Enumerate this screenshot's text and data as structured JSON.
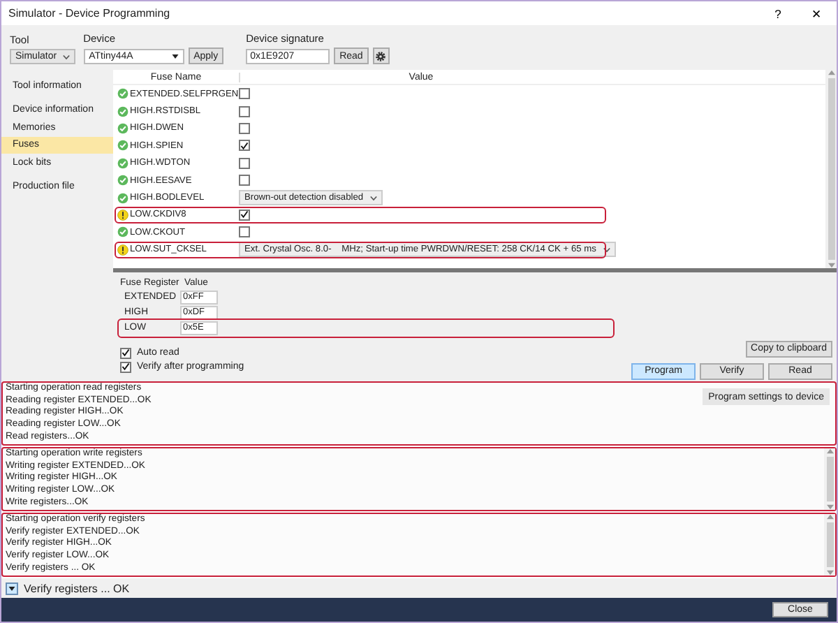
{
  "window": {
    "title": "Simulator - Device Programming",
    "help": "?",
    "close": "✕"
  },
  "toolbar": {
    "tool_label": "Tool",
    "tool": "Simulator",
    "device_label": "Device",
    "device": "ATtiny44A",
    "apply": "Apply",
    "signature_label": "Device signature",
    "signature": "0x1E9207",
    "read": "Read"
  },
  "sidebar": {
    "items": [
      {
        "label": "Tool information",
        "selected": false
      },
      {
        "label": "Device information",
        "selected": false
      },
      {
        "label": "Memories",
        "selected": false
      },
      {
        "label": "Fuses",
        "selected": true
      },
      {
        "label": "Lock bits",
        "selected": false
      },
      {
        "label": "Production file",
        "selected": false
      }
    ]
  },
  "fuses": {
    "columns": [
      "Fuse Name",
      "Value"
    ],
    "rows": [
      {
        "name": "EXTENDED.SELFPRGEN",
        "warning": false,
        "kind": "checkbox",
        "checked": false,
        "highlighted": false
      },
      {
        "name": "HIGH.RSTDISBL",
        "warning": false,
        "kind": "checkbox",
        "checked": false,
        "highlighted": false
      },
      {
        "name": "HIGH.DWEN",
        "warning": false,
        "kind": "checkbox",
        "checked": false,
        "highlighted": false
      },
      {
        "name": "HIGH.SPIEN",
        "warning": false,
        "kind": "checkbox",
        "checked": true,
        "highlighted": false
      },
      {
        "name": "HIGH.WDTON",
        "warning": false,
        "kind": "checkbox",
        "checked": false,
        "highlighted": false
      },
      {
        "name": "HIGH.EESAVE",
        "warning": false,
        "kind": "checkbox",
        "checked": false,
        "highlighted": false
      },
      {
        "name": "HIGH.BODLEVEL",
        "warning": false,
        "kind": "select",
        "value": "Brown-out detection disabled",
        "highlighted": false
      },
      {
        "name": "LOW.CKDIV8",
        "warning": true,
        "kind": "checkbox",
        "checked": true,
        "highlighted": true
      },
      {
        "name": "LOW.CKOUT",
        "warning": false,
        "kind": "checkbox",
        "checked": false,
        "highlighted": false
      },
      {
        "name": "LOW.SUT_CKSEL",
        "warning": true,
        "kind": "select",
        "value": "Ext. Crystal Osc. 8.0-    MHz; Start-up time PWRDWN/RESET: 258 CK/14 CK + 65 ms",
        "highlighted": true
      }
    ]
  },
  "registers": {
    "columns": [
      "Fuse Register",
      "Value"
    ],
    "rows": [
      {
        "name": "EXTENDED",
        "value": "0xFF",
        "highlighted": false
      },
      {
        "name": "HIGH",
        "value": "0xDF",
        "highlighted": false
      },
      {
        "name": "LOW",
        "value": "0x5E",
        "highlighted": true
      }
    ]
  },
  "options": [
    {
      "label": "Auto read",
      "checked": true
    },
    {
      "label": "Verify after programming",
      "checked": true
    }
  ],
  "copy_button": "Copy to clipboard",
  "actions": [
    {
      "label": "Program",
      "selected": true
    },
    {
      "label": "Verify",
      "selected": false
    },
    {
      "label": "Read",
      "selected": false
    }
  ],
  "logs": [
    {
      "highlighted": true,
      "button": "Program settings to device",
      "lines": [
        "Starting operation read registers",
        "Reading register EXTENDED...OK",
        "Reading register HIGH...OK",
        "Reading register LOW...OK",
        "Read registers...OK"
      ]
    },
    {
      "highlighted": true,
      "lines": [
        "Starting operation write registers",
        "Writing register EXTENDED...OK",
        "Writing register HIGH...OK",
        "Writing register LOW...OK",
        "Write registers...OK"
      ]
    },
    {
      "highlighted": true,
      "lines": [
        "Starting operation verify registers",
        "Verify register EXTENDED...OK",
        "Verify register HIGH...OK",
        "Verify register LOW...OK",
        "Verify registers ... OK"
      ]
    }
  ],
  "status_bar": {
    "text": "Verify registers ... OK"
  },
  "footer": {
    "close": "Close"
  }
}
